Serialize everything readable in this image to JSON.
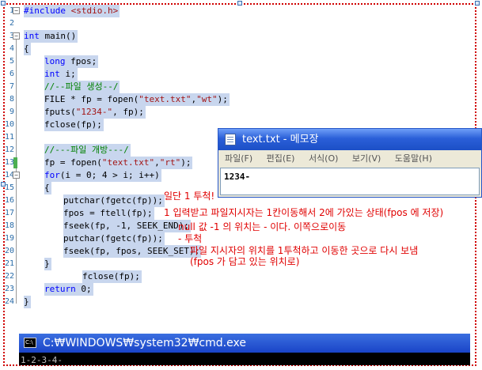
{
  "editor": {
    "line_numbers": [
      "1",
      "2",
      "3",
      "4",
      "5",
      "6",
      "7",
      "8",
      "9",
      "10",
      "11",
      "12",
      "13",
      "14",
      "15",
      "16",
      "17",
      "18",
      "19",
      "20",
      "21",
      "22",
      "23",
      "24"
    ],
    "lines": {
      "l1_pp": "#include ",
      "l1_hdr": "<stdio.h>",
      "l3_kw": "int",
      "l3_rest": " main()",
      "l4": "{",
      "l5_kw": "long",
      "l5_rest": " fpos;",
      "l6_kw": "int",
      "l6_rest": " i;",
      "l7": "//--파일 생성--/",
      "l8_a": "FILE * fp = fopen(",
      "l8_s1": "\"text.txt\"",
      "l8_b": ",",
      "l8_s2": "\"wt\"",
      "l8_c": ");",
      "l9_a": "fputs(",
      "l9_s": "\"1234-\"",
      "l9_b": ", fp);",
      "l10": "fclose(fp);",
      "l12": "//---파일 개방---/",
      "l13_a": "fp = fopen(",
      "l13_s1": "\"text.txt\"",
      "l13_b": ",",
      "l13_s2": "\"rt\"",
      "l13_c": ");",
      "l14_kw": "for",
      "l14_rest": "(i = 0; 4 > i; i++)",
      "l15": "{",
      "l16": "putchar(fgetc(fp));",
      "l17": "fpos = ftell(fp);",
      "l18": "fseek(fp, -1, SEEK_END);",
      "l19": "putchar(fgetc(fp));",
      "l20": "fseek(fp, fpos, SEEK_SET);",
      "l21": "}",
      "l22": "fclose(fp);",
      "l23_kw": "return",
      "l23_rest": " 0;",
      "l24": "}"
    }
  },
  "notepad": {
    "title": "text.txt - 메모장",
    "menu": [
      "파일(F)",
      "편집(E)",
      "서식(O)",
      "보기(V)",
      "도움말(H)"
    ],
    "content": "1234-"
  },
  "annotations": {
    "a1": "일단 1 투척!",
    "a2": "1 입력받고 파일지시자는 1칸이동해서 2에 가있는 상태(fpos 에 저장)",
    "a3": "null 값 -1 의 위치는 - 이다. 이쪽으로이동",
    "a4": "- 투척",
    "a5": "파일 지시자의 위치를 1투척하고 이동한 곳으로 다시 보냄",
    "a6": "(fpos 가 담고 있는 위치로)"
  },
  "cmd": {
    "title": "C:₩WINDOWS₩system32₩cmd.exe",
    "icon_text": "C:\\",
    "output": "1-2-3-4-"
  },
  "colors": {
    "selection": "#c8d6ee",
    "annotation": "#e00000",
    "frame": "#d00000"
  }
}
